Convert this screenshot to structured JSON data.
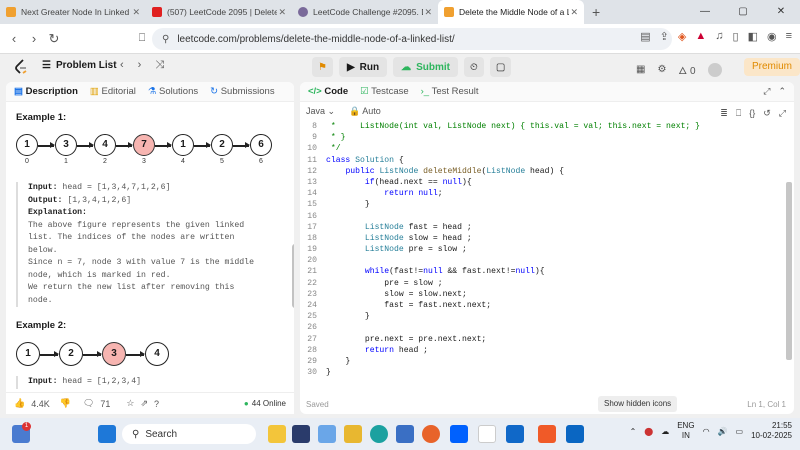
{
  "browser": {
    "tabs": [
      {
        "title": "Next Greater Node In Linked List - ",
        "color": "#f0a030"
      },
      {
        "title": "(507) LeetCode 2095 | Delete The M",
        "color": "#e02020"
      },
      {
        "title": "LeetCode Challenge #2095. Delete ",
        "color": "#7a6a9a"
      },
      {
        "title": "Delete the Middle Node of a Li",
        "color": "#f0a030"
      }
    ],
    "url": "leetcode.com/problems/delete-the-middle-node-of-a-linked-list/"
  },
  "header": {
    "problem_list": "Problem List",
    "run": "Run",
    "submit": "Submit",
    "flame_count": "0",
    "premium": "Premium"
  },
  "left": {
    "tabs": [
      "Description",
      "Editorial",
      "Solutions",
      "Submissions"
    ],
    "example1": {
      "title": "Example 1:",
      "nodes": [
        "1",
        "3",
        "4",
        "7",
        "1",
        "2",
        "6"
      ],
      "indices": [
        "0",
        "1",
        "2",
        "3",
        "4",
        "5",
        "6"
      ],
      "red_index": 3,
      "input_label": "Input:",
      "input_value": "head = [1,3,4,7,1,2,6]",
      "output_label": "Output:",
      "output_value": "[1,3,4,1,2,6]",
      "explanation_label": "Explanation:",
      "explanation_lines": [
        "The above figure represents the given linked",
        "list. The indices of the nodes are written",
        "below.",
        "Since n = 7, node 3 with value 7 is the middle",
        "node, which is marked in red.",
        "We return the new list after removing this",
        "node."
      ]
    },
    "example2": {
      "title": "Example 2:",
      "nodes": [
        "1",
        "2",
        "3",
        "4"
      ],
      "red_index": 2,
      "input_label": "Input:",
      "input_value": "head = [1,2,3,4]"
    },
    "footer": {
      "likes": "4.4K",
      "comments": "71",
      "online": "44 Online"
    }
  },
  "right": {
    "tabs": [
      "Code",
      "Testcase",
      "Test Result"
    ],
    "language": "Java",
    "mode": "Auto",
    "code_lines": [
      {
        "n": "8",
        "t": " *     ListNode(int val, ListNode next) { this.val = val; this.next = next; }",
        "c": "cm"
      },
      {
        "n": "9",
        "t": " * }",
        "c": "cm"
      },
      {
        "n": "10",
        "t": " */",
        "c": "cm"
      },
      {
        "n": "11",
        "t": "class Solution {",
        "c": "tx"
      },
      {
        "n": "12",
        "t": "    public ListNode deleteMiddle(ListNode head) {",
        "c": "tx"
      },
      {
        "n": "13",
        "t": "        if(head.next == null){",
        "c": "tx"
      },
      {
        "n": "14",
        "t": "            return null;",
        "c": "tx"
      },
      {
        "n": "15",
        "t": "        }",
        "c": "tx"
      },
      {
        "n": "16",
        "t": "",
        "c": "tx"
      },
      {
        "n": "17",
        "t": "        ListNode fast = head ;",
        "c": "tx"
      },
      {
        "n": "18",
        "t": "        ListNode slow = head ;",
        "c": "tx"
      },
      {
        "n": "19",
        "t": "        ListNode pre = slow ;",
        "c": "tx"
      },
      {
        "n": "20",
        "t": "",
        "c": "tx"
      },
      {
        "n": "21",
        "t": "        while(fast!=null && fast.next!=null){",
        "c": "tx"
      },
      {
        "n": "22",
        "t": "            pre = slow ;",
        "c": "tx"
      },
      {
        "n": "23",
        "t": "            slow = slow.next;",
        "c": "tx"
      },
      {
        "n": "24",
        "t": "            fast = fast.next.next;",
        "c": "tx"
      },
      {
        "n": "25",
        "t": "        }",
        "c": "tx"
      },
      {
        "n": "26",
        "t": "",
        "c": "tx"
      },
      {
        "n": "27",
        "t": "        pre.next = pre.next.next;",
        "c": "tx"
      },
      {
        "n": "28",
        "t": "        return head ;",
        "c": "tx"
      },
      {
        "n": "29",
        "t": "    }",
        "c": "tx"
      },
      {
        "n": "30",
        "t": "}",
        "c": "tx"
      }
    ],
    "footer": {
      "saved": "Saved",
      "show_hidden": "Show hidden icons",
      "cursor": "Ln 1, Col 1"
    }
  },
  "taskbar": {
    "search": "Search",
    "lang_top": "ENG",
    "lang_bottom": "IN",
    "time": "21:55",
    "date": "10-02-2025",
    "notif": "1"
  }
}
